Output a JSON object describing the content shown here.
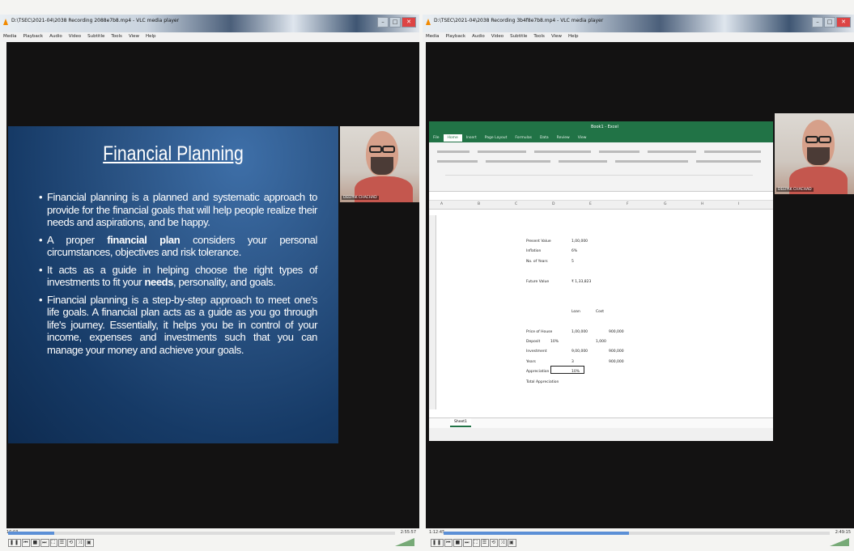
{
  "left_window": {
    "title": "D:\\TSEC\\2021-04\\2038 Recording 2088e7b8.mp4 - VLC media player",
    "menu": [
      "Media",
      "Playback",
      "Audio",
      "Video",
      "Subtitle",
      "Tools",
      "View",
      "Help"
    ],
    "time_elapsed": "10:03",
    "time_total": "2:55:57",
    "progress": 0.12,
    "webcam_name": "DEEPAK CHACHAD",
    "slide": {
      "title": "Financial Planning",
      "bullets": [
        {
          "pre": "Financial planning is a planned and systematic approach to provide for the financial goals that will help people realize their needs and aspirations, and be happy.",
          "bold": "",
          "post": ""
        },
        {
          "pre": "A proper ",
          "bold": "financial plan",
          "post": " considers your personal circumstances, objectives and risk tolerance."
        },
        {
          "pre": "It acts as a guide in helping choose the right types of investments to fit your ",
          "bold": "needs",
          "post": ", personality, and goals."
        },
        {
          "pre": "Financial planning is a step-by-step approach to meet one's life goals. A financial plan acts as a guide as you go through life's journey. Essentially, it helps you be in control of your income, expenses and investments such that you can manage your money and achieve your goals.",
          "bold": "",
          "post": ""
        }
      ]
    }
  },
  "right_window": {
    "title": "D:\\TSEC\\2021-04\\2038 Recording 3b4f8e7b8.mp4 - VLC media player",
    "menu": [
      "Media",
      "Playback",
      "Audio",
      "Video",
      "Subtitle",
      "Tools",
      "View",
      "Help"
    ],
    "time_elapsed": "1:12:45",
    "time_total": "2:49:15",
    "progress": 0.48,
    "webcam_name": "DEEPAK CHACHAD",
    "excel": {
      "title": "Book1 - Excel",
      "tabs": [
        "File",
        "Home",
        "Insert",
        "Page Layout",
        "Formulas",
        "Data",
        "Review",
        "View"
      ],
      "sheet_tab": "Sheet1",
      "cells": [
        {
          "text": "Present Value",
          "col": "a",
          "row": 0
        },
        {
          "text": "1,00,000",
          "col": "b",
          "row": 0
        },
        {
          "text": "Inflation",
          "col": "a",
          "row": 1
        },
        {
          "text": "6%",
          "col": "b",
          "row": 1
        },
        {
          "text": "No. of Years",
          "col": "a",
          "row": 2
        },
        {
          "text": "5",
          "col": "b",
          "row": 2
        },
        {
          "text": "Future Value",
          "col": "a",
          "row": 4
        },
        {
          "text": "₹ 1,33,823",
          "col": "b",
          "row": 4
        },
        {
          "text": "Loan",
          "col": "b",
          "row": 7
        },
        {
          "text": "Cost",
          "col": "c",
          "row": 7
        },
        {
          "text": "Price of House",
          "col": "a",
          "row": 9
        },
        {
          "text": "1,00,000",
          "col": "b",
          "row": 9
        },
        {
          "text": "900,000",
          "col": "d",
          "row": 9
        },
        {
          "text": "Deposit",
          "col": "a",
          "row": 10
        },
        {
          "text": "10%",
          "col": "a2",
          "row": 10
        },
        {
          "text": "1,000",
          "col": "c",
          "row": 10
        },
        {
          "text": "Investment",
          "col": "a",
          "row": 11
        },
        {
          "text": "9,00,000",
          "col": "b",
          "row": 11
        },
        {
          "text": "900,000",
          "col": "d",
          "row": 11
        },
        {
          "text": "Years",
          "col": "a",
          "row": 12
        },
        {
          "text": "3",
          "col": "b",
          "row": 12
        },
        {
          "text": "900,000",
          "col": "d",
          "row": 12
        },
        {
          "text": "Appreciation",
          "col": "a",
          "row": 13
        },
        {
          "text": "10%",
          "col": "b",
          "row": 13
        },
        {
          "text": "Total Appreciation",
          "col": "a",
          "row": 14
        }
      ]
    }
  }
}
